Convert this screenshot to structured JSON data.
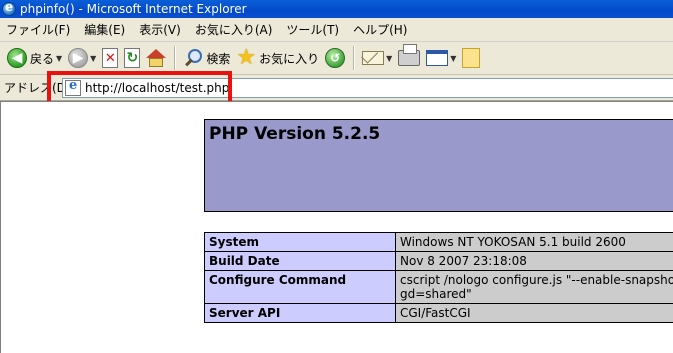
{
  "window": {
    "title": "phpinfo() - Microsoft Internet Explorer"
  },
  "menu": {
    "items": [
      "ファイル(F)",
      "編集(E)",
      "表示(V)",
      "お気に入り(A)",
      "ツール(T)",
      "ヘルプ(H)"
    ]
  },
  "toolbar": {
    "back_label": "戻る",
    "search_label": "検索",
    "favorites_label": "お気に入り"
  },
  "address": {
    "label": "アドレス(D)",
    "value": "http://localhost/test.php"
  },
  "page": {
    "heading": "PHP Version 5.2.5",
    "rows": [
      {
        "key": "System",
        "value": "Windows NT YOKOSAN 5.1 build 2600"
      },
      {
        "key": "Build Date",
        "value": "Nov 8 2007 23:18:08"
      },
      {
        "key": "Configure Command",
        "value": "cscript /nologo configure.js \"--enable-snapsho"
      },
      {
        "key": "",
        "value": "gd=shared\""
      },
      {
        "key": "Server API",
        "value": "CGI/FastCGI"
      }
    ]
  },
  "colors": {
    "highlight": "#e8130f",
    "header_bg": "#9999cc",
    "key_bg": "#ccccff",
    "value_bg": "#cccccc"
  },
  "icons": [
    "ie-icon",
    "back-icon",
    "forward-icon",
    "stop-icon",
    "refresh-icon",
    "home-icon",
    "search-icon",
    "favorites-star-icon",
    "history-icon",
    "mail-icon",
    "print-icon",
    "edit-icon",
    "note-icon",
    "page-icon"
  ]
}
